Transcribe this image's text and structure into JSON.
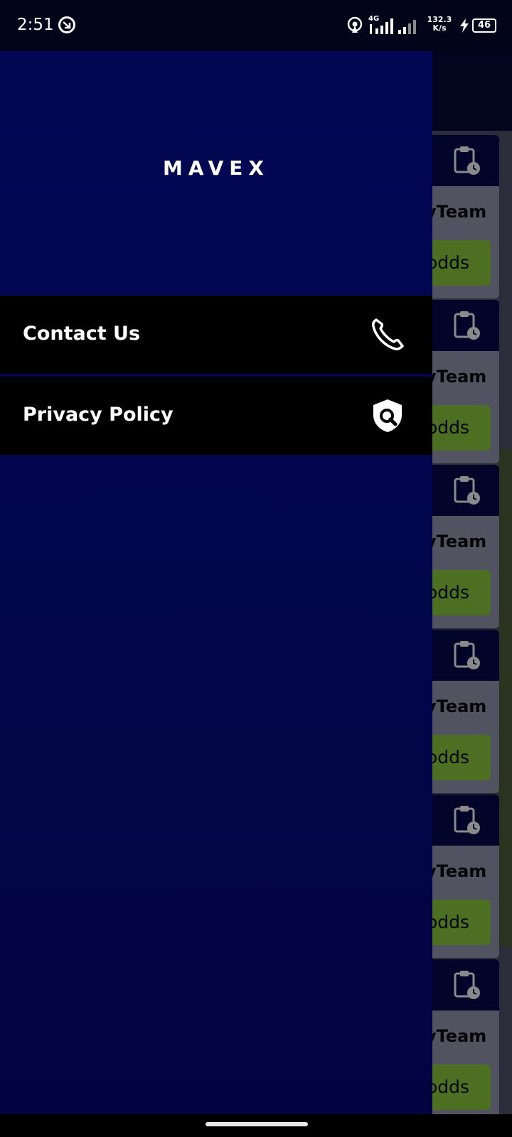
{
  "status_bar": {
    "time": "2:51",
    "network_type": "4G",
    "speed_value": "132.3",
    "speed_unit": "K/s",
    "battery": "46"
  },
  "background_app": {
    "cards": [
      {
        "team_fragment": "yTeam",
        "odds_fragment": "odds"
      },
      {
        "team_fragment": "yTeam",
        "odds_fragment": "odds"
      },
      {
        "team_fragment": "yTeam",
        "odds_fragment": "odds"
      },
      {
        "team_fragment": "yTeam",
        "odds_fragment": "odds"
      },
      {
        "team_fragment": "yTeam",
        "odds_fragment": "odds"
      },
      {
        "team_fragment": "yTeam",
        "odds_fragment": "odds"
      }
    ],
    "card_icon": "clipboard-clock-icon"
  },
  "drawer": {
    "brand": "MAVEX",
    "items": [
      {
        "label": "Contact Us",
        "icon": "phone-icon"
      },
      {
        "label": "Privacy Policy",
        "icon": "shield-search-icon"
      }
    ]
  },
  "colors": {
    "drawer_bg": "#030754",
    "menu_item_bg": "#000000",
    "odds_button": "#4c6f22",
    "text": "#ffffff"
  }
}
